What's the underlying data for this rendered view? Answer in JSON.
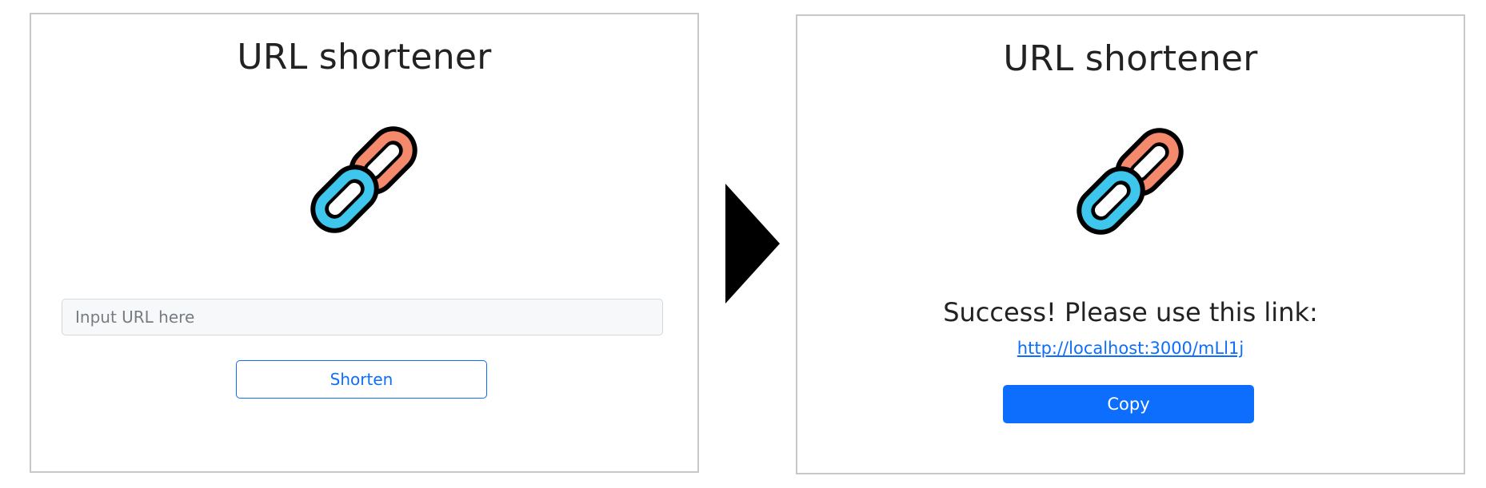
{
  "before": {
    "title": "URL shortener",
    "logo_icon": "chain-link-icon",
    "input": {
      "value": "",
      "placeholder": "Input URL here"
    },
    "shorten_label": "Shorten"
  },
  "transition_icon": "right-triangle-arrow-icon",
  "after": {
    "title": "URL shortener",
    "logo_icon": "chain-link-icon",
    "success_message": "Success! Please use this link:",
    "short_link": "http://localhost:3000/mLl1j",
    "copy_label": "Copy"
  },
  "colors": {
    "link_orange": "#F4896B",
    "link_blue": "#3EC6EC",
    "primary": "#0D6EFD",
    "panel_border": "#C8C8C8"
  }
}
